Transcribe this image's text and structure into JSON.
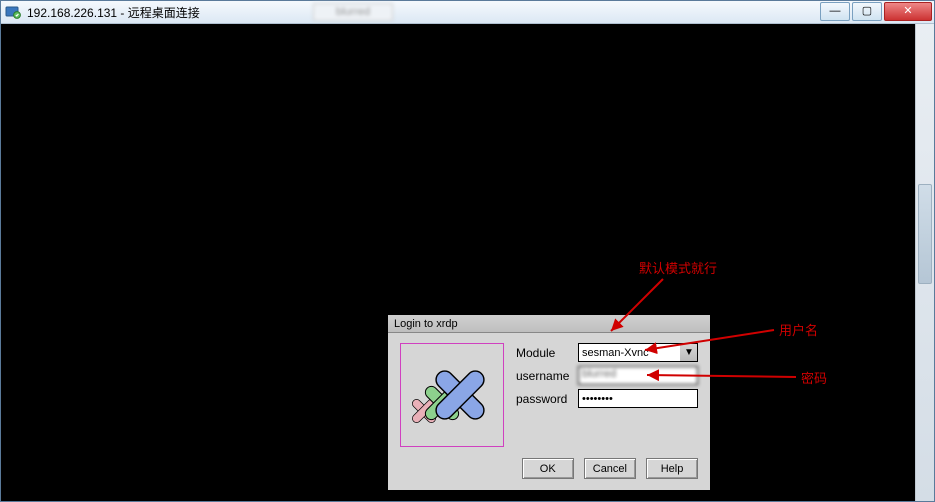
{
  "window": {
    "title": "192.168.226.131 - 远程桌面连接",
    "blurred_tab": "blurred"
  },
  "controls": {
    "minimize": "—",
    "maximize": "▢",
    "close": "✕"
  },
  "xrdp": {
    "title": "Login to xrdp",
    "labels": {
      "module": "Module",
      "username": "username",
      "password": "password"
    },
    "module_value": "sesman-Xvnc",
    "username_value": "blurred",
    "password_value": "********",
    "buttons": {
      "ok": "OK",
      "cancel": "Cancel",
      "help": "Help"
    }
  },
  "annotations": {
    "module": "默认模式就行",
    "username": "用户名",
    "password": "密码"
  }
}
